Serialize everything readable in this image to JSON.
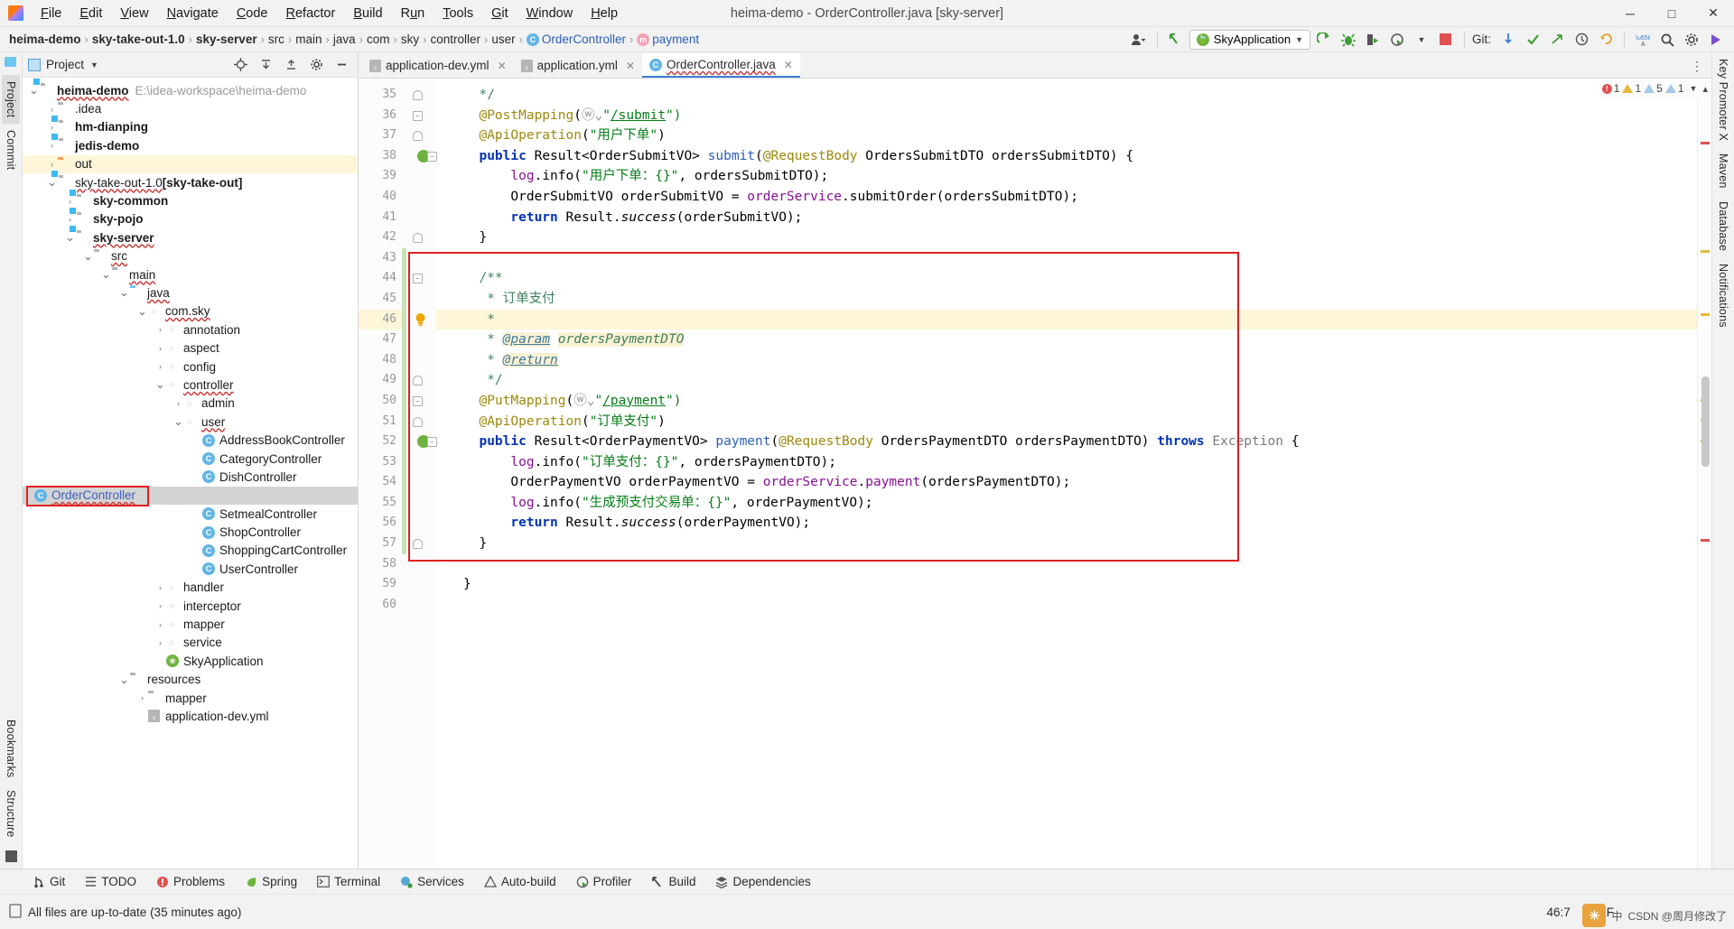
{
  "window": {
    "title": "heima-demo - OrderController.java [sky-server]",
    "minimize": "─",
    "maximize": "□",
    "close": "✕"
  },
  "menubar": [
    {
      "label": "File",
      "mnemonic": "F"
    },
    {
      "label": "Edit",
      "mnemonic": "E"
    },
    {
      "label": "View",
      "mnemonic": "V"
    },
    {
      "label": "Navigate",
      "mnemonic": "N"
    },
    {
      "label": "Code",
      "mnemonic": "C"
    },
    {
      "label": "Refactor",
      "mnemonic": "R"
    },
    {
      "label": "Build",
      "mnemonic": "B"
    },
    {
      "label": "Run",
      "mnemonic": "u"
    },
    {
      "label": "Tools",
      "mnemonic": "T"
    },
    {
      "label": "Git",
      "mnemonic": "G"
    },
    {
      "label": "Window",
      "mnemonic": "W"
    },
    {
      "label": "Help",
      "mnemonic": "H"
    }
  ],
  "breadcrumb": [
    {
      "label": "heima-demo",
      "style": "bold"
    },
    {
      "label": "sky-take-out-1.0",
      "style": "bold"
    },
    {
      "label": "sky-server",
      "style": "bold"
    },
    {
      "label": "src",
      "style": "plain"
    },
    {
      "label": "main",
      "style": "plain"
    },
    {
      "label": "java",
      "style": "plain"
    },
    {
      "label": "com",
      "style": "plain"
    },
    {
      "label": "sky",
      "style": "plain"
    },
    {
      "label": "controller",
      "style": "plain"
    },
    {
      "label": "user",
      "style": "plain"
    },
    {
      "label": "OrderController",
      "style": "class",
      "icon": "class-icon"
    },
    {
      "label": "payment",
      "style": "method",
      "icon": "method-icon"
    }
  ],
  "toolbar": {
    "run_config": "SkyApplication",
    "git_label": "Git:",
    "icons": [
      "account-icon",
      "back-arrow-icon",
      "run-icon",
      "debug-icon",
      "run-coverage-icon",
      "profiler-icon",
      "stop-icon",
      "git-update-icon",
      "git-commit-icon",
      "git-push-icon",
      "history-icon",
      "undo-icon",
      "translate-icon",
      "search-icon",
      "settings-icon",
      "run-anything-icon"
    ]
  },
  "left_rail": {
    "top": [
      "Project",
      "Commit"
    ],
    "bottom": [
      "Bookmarks",
      "Structure"
    ]
  },
  "right_rail": {
    "items": [
      "Key Promoter X",
      "Maven",
      "Database",
      "Notifications"
    ]
  },
  "project_panel": {
    "title": "Project",
    "header_icons": [
      "locate-icon",
      "expand-all-icon",
      "collapse-all-icon",
      "settings-icon",
      "hide-icon"
    ],
    "tree": [
      {
        "indent": 0,
        "arrow": "down",
        "icon": "folder-module",
        "label": "heima-demo",
        "bold": true,
        "wavy": true,
        "sub": "E:\\idea-workspace\\heima-demo"
      },
      {
        "indent": 1,
        "arrow": "right",
        "icon": "folder-gray",
        "label": ".idea",
        "bold": false,
        "wavy": false
      },
      {
        "indent": 1,
        "arrow": "right",
        "icon": "folder-module",
        "label": "hm-dianping",
        "bold": true,
        "wavy": false
      },
      {
        "indent": 1,
        "arrow": "right",
        "icon": "folder-module",
        "label": "jedis-demo",
        "bold": true,
        "wavy": false
      },
      {
        "indent": 1,
        "arrow": "right",
        "icon": "folder-orange",
        "label": "out",
        "bold": false,
        "wavy": false,
        "row_highlight": true
      },
      {
        "indent": 1,
        "arrow": "down",
        "icon": "folder-module",
        "label": "sky-take-out-1.0",
        "bold": false,
        "wavy": true,
        "suffix": " [sky-take-out]"
      },
      {
        "indent": 2,
        "arrow": "right",
        "icon": "folder-module",
        "label": "sky-common",
        "bold": true,
        "wavy": false
      },
      {
        "indent": 2,
        "arrow": "right",
        "icon": "folder-module",
        "label": "sky-pojo",
        "bold": true,
        "wavy": false
      },
      {
        "indent": 2,
        "arrow": "down",
        "icon": "folder-module",
        "label": "sky-server",
        "bold": true,
        "wavy": true
      },
      {
        "indent": 3,
        "arrow": "down",
        "icon": "folder-gray",
        "label": "src",
        "bold": false,
        "wavy": true
      },
      {
        "indent": 4,
        "arrow": "down",
        "icon": "folder-gray",
        "label": "main",
        "bold": false,
        "wavy": true
      },
      {
        "indent": 5,
        "arrow": "down",
        "icon": "folder-blue",
        "label": "java",
        "bold": false,
        "wavy": true
      },
      {
        "indent": 6,
        "arrow": "down",
        "icon": "package-icon",
        "label": "com.sky",
        "bold": false,
        "wavy": true
      },
      {
        "indent": 7,
        "arrow": "right",
        "icon": "package-icon",
        "label": "annotation",
        "bold": false,
        "wavy": false
      },
      {
        "indent": 7,
        "arrow": "right",
        "icon": "package-icon",
        "label": "aspect",
        "bold": false,
        "wavy": false
      },
      {
        "indent": 7,
        "arrow": "right",
        "icon": "package-icon",
        "label": "config",
        "bold": false,
        "wavy": false
      },
      {
        "indent": 7,
        "arrow": "down",
        "icon": "package-icon",
        "label": "controller",
        "bold": false,
        "wavy": true
      },
      {
        "indent": 8,
        "arrow": "right",
        "icon": "package-icon",
        "label": "admin",
        "bold": false,
        "wavy": false
      },
      {
        "indent": 8,
        "arrow": "down",
        "icon": "package-icon",
        "label": "user",
        "bold": false,
        "wavy": true
      },
      {
        "indent": 9,
        "arrow": "none",
        "icon": "class-icon",
        "label": "AddressBookController",
        "bold": false,
        "wavy": false
      },
      {
        "indent": 9,
        "arrow": "none",
        "icon": "class-icon",
        "label": "CategoryController",
        "bold": false,
        "wavy": false
      },
      {
        "indent": 9,
        "arrow": "none",
        "icon": "class-icon",
        "label": "DishController",
        "bold": false,
        "wavy": false
      },
      {
        "indent": 9,
        "arrow": "none",
        "icon": "class-icon",
        "label": "OrderController",
        "bold": false,
        "wavy": true,
        "selected": true,
        "link": true,
        "boxed": true
      },
      {
        "indent": 9,
        "arrow": "none",
        "icon": "class-icon",
        "label": "SetmealController",
        "bold": false,
        "wavy": false
      },
      {
        "indent": 9,
        "arrow": "none",
        "icon": "class-icon",
        "label": "ShopController",
        "bold": false,
        "wavy": false
      },
      {
        "indent": 9,
        "arrow": "none",
        "icon": "class-icon",
        "label": "ShoppingCartController",
        "bold": false,
        "wavy": false
      },
      {
        "indent": 9,
        "arrow": "none",
        "icon": "class-icon",
        "label": "UserController",
        "bold": false,
        "wavy": false
      },
      {
        "indent": 7,
        "arrow": "right",
        "icon": "package-icon",
        "label": "handler",
        "bold": false,
        "wavy": false
      },
      {
        "indent": 7,
        "arrow": "right",
        "icon": "package-icon",
        "label": "interceptor",
        "bold": false,
        "wavy": false
      },
      {
        "indent": 7,
        "arrow": "right",
        "icon": "package-icon",
        "label": "mapper",
        "bold": false,
        "wavy": false
      },
      {
        "indent": 7,
        "arrow": "right",
        "icon": "package-icon",
        "label": "service",
        "bold": false,
        "wavy": false
      },
      {
        "indent": 7,
        "arrow": "none",
        "icon": "spring-icon",
        "label": "SkyApplication",
        "bold": false,
        "wavy": false
      },
      {
        "indent": 5,
        "arrow": "down",
        "icon": "folder-gray",
        "label": "resources",
        "bold": false,
        "wavy": false
      },
      {
        "indent": 6,
        "arrow": "right",
        "icon": "folder-gray",
        "label": "mapper",
        "bold": false,
        "wavy": false
      },
      {
        "indent": 6,
        "arrow": "none",
        "icon": "yaml-icon",
        "label": "application-dev.yml",
        "bold": false,
        "wavy": false,
        "clipped": true
      }
    ]
  },
  "editor": {
    "tabs": [
      {
        "label": "application-dev.yml",
        "icon": "yaml-icon",
        "active": false
      },
      {
        "label": "application.yml",
        "icon": "yaml-icon",
        "active": false
      },
      {
        "label": "OrderController.java",
        "icon": "class-icon",
        "active": true
      }
    ],
    "inspections": {
      "errors": "1",
      "warnings": "1",
      "weak_warnings": "5",
      "infos": "1"
    },
    "lines": [
      {
        "n": 35,
        "tokens": [
          {
            "t": "  */",
            "c": "jdoc"
          }
        ],
        "fold": "c"
      },
      {
        "n": 36,
        "tokens": [
          {
            "t": "  ",
            "c": "ident"
          },
          {
            "t": "@PostMapping",
            "c": "ann"
          },
          {
            "t": "(",
            "c": "ident"
          },
          {
            "t": "ⓦ⌄",
            "c": "cmt"
          },
          {
            "t": "\"",
            "c": "str"
          },
          {
            "t": "/submit",
            "c": "url"
          },
          {
            "t": "\")",
            "c": "str"
          }
        ],
        "fold": "f"
      },
      {
        "n": 37,
        "tokens": [
          {
            "t": "  ",
            "c": "ident"
          },
          {
            "t": "@ApiOperation",
            "c": "ann"
          },
          {
            "t": "(",
            "c": "ident"
          },
          {
            "t": "\"用户下单\"",
            "c": "str"
          },
          {
            "t": ")",
            "c": "ident"
          }
        ],
        "fold": "c"
      },
      {
        "n": 38,
        "tokens": [
          {
            "t": "  ",
            "c": "ident"
          },
          {
            "t": "public",
            "c": "kw"
          },
          {
            "t": " Result<OrderSubmitVO> ",
            "c": "typ"
          },
          {
            "t": "submit",
            "c": "mth"
          },
          {
            "t": "(",
            "c": "ident"
          },
          {
            "t": "@RequestBody",
            "c": "ann"
          },
          {
            "t": " OrdersSubmitDTO ordersSubmitDTO) {",
            "c": "ident"
          }
        ],
        "bean": true,
        "fold": "f"
      },
      {
        "n": 39,
        "tokens": [
          {
            "t": "      ",
            "c": "ident"
          },
          {
            "t": "log",
            "c": "fld"
          },
          {
            "t": ".info(",
            "c": "ident"
          },
          {
            "t": "\"用户下单：{}\"",
            "c": "str"
          },
          {
            "t": ", ordersSubmitDTO);",
            "c": "ident"
          }
        ]
      },
      {
        "n": 40,
        "tokens": [
          {
            "t": "      OrderSubmitVO orderSubmitVO = ",
            "c": "ident"
          },
          {
            "t": "orderService",
            "c": "fld"
          },
          {
            "t": ".submitOrder(ordersSubmitDTO);",
            "c": "ident"
          }
        ]
      },
      {
        "n": 41,
        "tokens": [
          {
            "t": "      ",
            "c": "ident"
          },
          {
            "t": "return",
            "c": "kw"
          },
          {
            "t": " Result.",
            "c": "ident"
          },
          {
            "t": "success",
            "c": "ital"
          },
          {
            "t": "(orderSubmitVO);",
            "c": "ident"
          }
        ]
      },
      {
        "n": 42,
        "tokens": [
          {
            "t": "  }",
            "c": "ident"
          }
        ],
        "fold": "c"
      },
      {
        "n": 43,
        "tokens": [
          {
            "t": "",
            "c": "ident"
          }
        ]
      },
      {
        "n": 44,
        "tokens": [
          {
            "t": "  ",
            "c": "ident"
          },
          {
            "t": "/**",
            "c": "jdoc"
          }
        ],
        "fold": "f"
      },
      {
        "n": 45,
        "tokens": [
          {
            "t": "   ",
            "c": "ident"
          },
          {
            "t": "* 订单支付",
            "c": "jdoc"
          }
        ]
      },
      {
        "n": 46,
        "tokens": [
          {
            "t": "   ",
            "c": "ident"
          },
          {
            "t": "*",
            "c": "jdoc"
          }
        ],
        "bulb": true,
        "highlight": true
      },
      {
        "n": 47,
        "tokens": [
          {
            "t": "   ",
            "c": "ident"
          },
          {
            "t": "* ",
            "c": "jdoc"
          },
          {
            "t": "@param",
            "c": "jdoc-tag"
          },
          {
            "t": " ",
            "c": "jdoc"
          },
          {
            "t": "ordersPaymentDTO",
            "c": "jdoc-hl"
          }
        ]
      },
      {
        "n": 48,
        "tokens": [
          {
            "t": "   ",
            "c": "ident"
          },
          {
            "t": "* ",
            "c": "jdoc"
          },
          {
            "t": "@return",
            "c": "jdoc-tag"
          }
        ]
      },
      {
        "n": 49,
        "tokens": [
          {
            "t": "   ",
            "c": "ident"
          },
          {
            "t": "*/",
            "c": "jdoc"
          }
        ],
        "fold": "c"
      },
      {
        "n": 50,
        "tokens": [
          {
            "t": "  ",
            "c": "ident"
          },
          {
            "t": "@PutMapping",
            "c": "ann"
          },
          {
            "t": "(",
            "c": "ident"
          },
          {
            "t": "ⓦ⌄",
            "c": "cmt"
          },
          {
            "t": "\"",
            "c": "str"
          },
          {
            "t": "/payment",
            "c": "url"
          },
          {
            "t": "\")",
            "c": "str"
          }
        ],
        "fold": "f"
      },
      {
        "n": 51,
        "tokens": [
          {
            "t": "  ",
            "c": "ident"
          },
          {
            "t": "@ApiOperation",
            "c": "ann"
          },
          {
            "t": "(",
            "c": "ident"
          },
          {
            "t": "\"订单支付\"",
            "c": "str"
          },
          {
            "t": ")",
            "c": "ident"
          }
        ],
        "fold": "c"
      },
      {
        "n": 52,
        "tokens": [
          {
            "t": "  ",
            "c": "ident"
          },
          {
            "t": "public",
            "c": "kw"
          },
          {
            "t": " Result<OrderPaymentVO> ",
            "c": "typ"
          },
          {
            "t": "payment",
            "c": "mth"
          },
          {
            "t": "(",
            "c": "ident"
          },
          {
            "t": "@RequestBody",
            "c": "ann"
          },
          {
            "t": " OrdersPaymentDTO ordersPaymentDTO) ",
            "c": "ident"
          },
          {
            "t": "throws",
            "c": "kw"
          },
          {
            "t": " ",
            "c": "ident"
          },
          {
            "t": "Exception",
            "c": "typ-gray"
          },
          {
            "t": " {",
            "c": "ident"
          }
        ],
        "bean": true,
        "fold": "f"
      },
      {
        "n": 53,
        "tokens": [
          {
            "t": "      ",
            "c": "ident"
          },
          {
            "t": "log",
            "c": "fld"
          },
          {
            "t": ".info(",
            "c": "ident"
          },
          {
            "t": "\"订单支付：{}\"",
            "c": "str"
          },
          {
            "t": ", ordersPaymentDTO);",
            "c": "ident"
          }
        ]
      },
      {
        "n": 54,
        "tokens": [
          {
            "t": "      OrderPaymentVO orderPaymentVO = ",
            "c": "ident"
          },
          {
            "t": "orderService",
            "c": "fld"
          },
          {
            "t": ".",
            "c": "ident"
          },
          {
            "t": "payment",
            "c": "fld"
          },
          {
            "t": "(ordersPaymentDTO);",
            "c": "ident"
          }
        ]
      },
      {
        "n": 55,
        "tokens": [
          {
            "t": "      ",
            "c": "ident"
          },
          {
            "t": "log",
            "c": "fld"
          },
          {
            "t": ".info(",
            "c": "ident"
          },
          {
            "t": "\"生成预支付交易单：{}\"",
            "c": "str"
          },
          {
            "t": ", orderPaymentVO);",
            "c": "ident"
          }
        ]
      },
      {
        "n": 56,
        "tokens": [
          {
            "t": "      ",
            "c": "ident"
          },
          {
            "t": "return",
            "c": "kw"
          },
          {
            "t": " Result.",
            "c": "ident"
          },
          {
            "t": "success",
            "c": "ital"
          },
          {
            "t": "(orderPaymentVO);",
            "c": "ident"
          }
        ]
      },
      {
        "n": 57,
        "tokens": [
          {
            "t": "  }",
            "c": "ident"
          }
        ],
        "fold": "c"
      },
      {
        "n": 58,
        "tokens": [
          {
            "t": "",
            "c": "ident"
          }
        ]
      },
      {
        "n": 59,
        "tokens": [
          {
            "t": "}",
            "c": "ident"
          }
        ]
      },
      {
        "n": 60,
        "tokens": [
          {
            "t": "",
            "c": "ident"
          }
        ]
      }
    ]
  },
  "tool_windows": [
    {
      "label": "Git",
      "icon": "git-icon"
    },
    {
      "label": "TODO",
      "icon": "todo-icon"
    },
    {
      "label": "Problems",
      "icon": "problems-icon"
    },
    {
      "label": "Spring",
      "icon": "spring-icon"
    },
    {
      "label": "Terminal",
      "icon": "terminal-icon"
    },
    {
      "label": "Services",
      "icon": "services-icon"
    },
    {
      "label": "Auto-build",
      "icon": "autobuild-icon"
    },
    {
      "label": "Profiler",
      "icon": "profiler-icon"
    },
    {
      "label": "Build",
      "icon": "build-icon"
    },
    {
      "label": "Dependencies",
      "icon": "dependencies-icon"
    }
  ],
  "status_bar": {
    "message": "All files are up-to-date (35 minutes ago)",
    "caret": "46:7",
    "line_separator": "CRLF",
    "ime": "中",
    "watermark": "CSDN @周月修改了"
  }
}
